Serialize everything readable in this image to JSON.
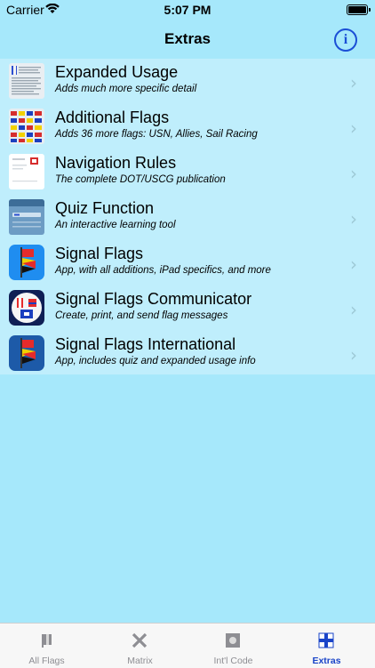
{
  "status": {
    "carrier": "Carrier",
    "time": "5:07 PM"
  },
  "nav": {
    "title": "Extras",
    "info_icon": "info-icon"
  },
  "rows": [
    {
      "title": "Expanded Usage",
      "subtitle": "Adds much more specific detail",
      "icon": "document-thumbnail"
    },
    {
      "title": "Additional Flags",
      "subtitle": "Adds 36 more flags: USN, Allies, Sail Racing",
      "icon": "flag-grid-thumbnail"
    },
    {
      "title": "Navigation Rules",
      "subtitle": "The complete DOT/USCG publication",
      "icon": "publication-thumbnail"
    },
    {
      "title": "Quiz Function",
      "subtitle": "An interactive learning tool",
      "icon": "quiz-screen-thumbnail"
    },
    {
      "title": "Signal Flags",
      "subtitle": "App, with all additions, iPad specifics, and more",
      "icon": "signal-flags-app-icon"
    },
    {
      "title": "Signal Flags Communicator",
      "subtitle": "Create, print, and send flag messages",
      "icon": "communicator-app-icon"
    },
    {
      "title": "Signal Flags International",
      "subtitle": "App, includes quiz and expanded usage info",
      "icon": "international-app-icon"
    }
  ],
  "tabs": [
    {
      "label": "All Flags",
      "icon": "flag-icon",
      "active": false
    },
    {
      "label": "Matrix",
      "icon": "x-cross-icon",
      "active": false
    },
    {
      "label": "Int'l Code",
      "icon": "square-dot-icon",
      "active": false
    },
    {
      "label": "Extras",
      "icon": "cross-flag-icon",
      "active": true
    }
  ],
  "colors": {
    "background": "#a6e8fb",
    "list_background": "#bfeefc",
    "accent": "#1a44c8"
  }
}
